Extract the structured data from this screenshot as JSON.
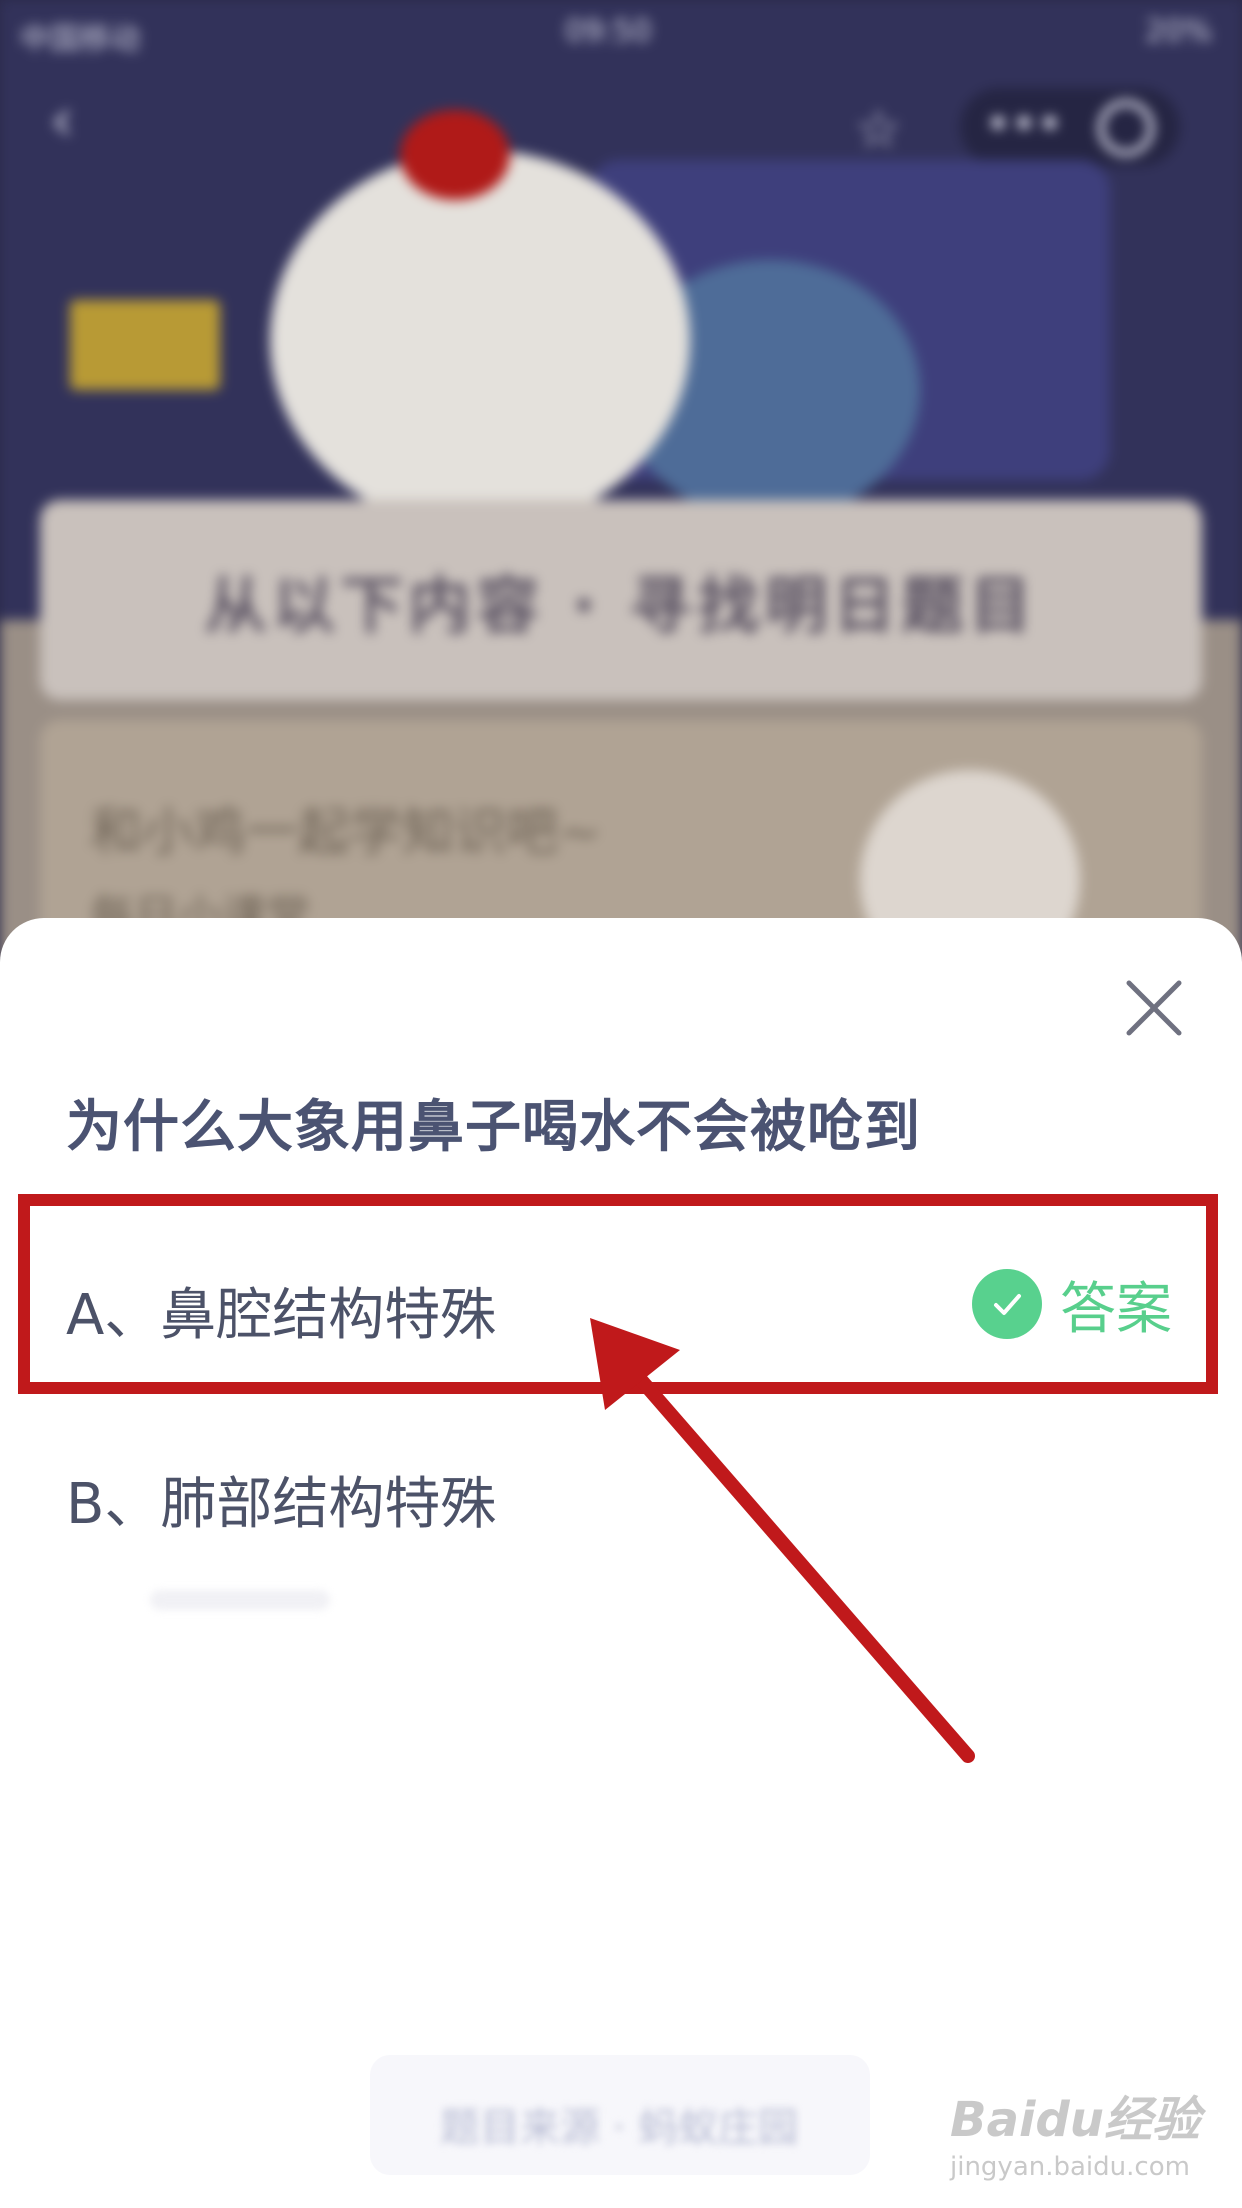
{
  "background": {
    "status_bar": {
      "carrier": "中国移动",
      "time": "09:50",
      "battery": "20%"
    },
    "banner_heading": "从以下内容 · 寻找明日题目",
    "learn_card": {
      "title": "和小鸡一起学知识吧~",
      "subtitle": "每日小课堂"
    },
    "footer_text": "题目来源 · 蚂蚁庄园"
  },
  "sheet": {
    "question": "为什么大象用鼻子喝水不会被呛到",
    "options": [
      {
        "label": "A、鼻腔结构特殊",
        "is_answer": true,
        "answer_badge": "答案"
      },
      {
        "label": "B、肺部结构特殊",
        "is_answer": false
      }
    ]
  },
  "colors": {
    "accent_green": "#58d18e",
    "question_text": "#4b5372",
    "highlight_red": "#c0191b"
  },
  "watermark": {
    "logo": "Baidu经验",
    "url": "jingyan.baidu.com"
  }
}
